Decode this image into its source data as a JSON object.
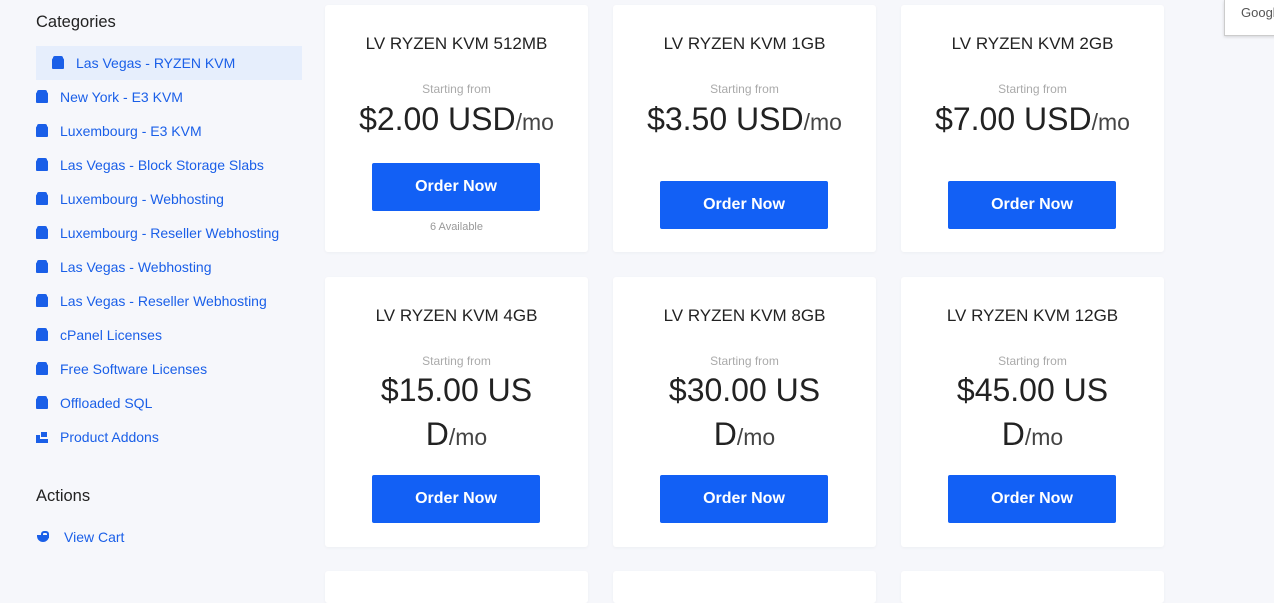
{
  "sidebar": {
    "categories_title": "Categories",
    "categories": [
      {
        "label": "Las Vegas - RYZEN KVM",
        "icon": "box-icon",
        "active": true
      },
      {
        "label": "New York - E3 KVM",
        "icon": "box-icon"
      },
      {
        "label": "Luxembourg - E3 KVM",
        "icon": "box-icon"
      },
      {
        "label": "Las Vegas - Block Storage Slabs",
        "icon": "box-icon"
      },
      {
        "label": "Luxembourg - Webhosting",
        "icon": "box-icon"
      },
      {
        "label": "Luxembourg - Reseller Webhosting",
        "icon": "box-icon"
      },
      {
        "label": "Las Vegas - Webhosting",
        "icon": "box-icon"
      },
      {
        "label": "Las Vegas - Reseller Webhosting",
        "icon": "box-icon"
      },
      {
        "label": "cPanel Licenses",
        "icon": "box-icon"
      },
      {
        "label": "Free Software Licenses",
        "icon": "box-icon"
      },
      {
        "label": "Offloaded SQL",
        "icon": "box-icon"
      },
      {
        "label": "Product Addons",
        "icon": "addons-icon"
      }
    ],
    "actions_title": "Actions",
    "actions": [
      {
        "label": "View Cart",
        "icon": "cart-icon"
      }
    ]
  },
  "products": [
    {
      "name": "LV RYZEN KVM 512MB",
      "starting": "Starting from",
      "price": "$2.00 USD",
      "period": "/mo",
      "button": "Order Now",
      "availability": "6 Available"
    },
    {
      "name": "LV RYZEN KVM 1GB",
      "starting": "Starting from",
      "price": "$3.50 USD",
      "period": "/mo",
      "button": "Order Now"
    },
    {
      "name": "LV RYZEN KVM 2GB",
      "starting": "Starting from",
      "price": "$7.00 USD",
      "period": "/mo",
      "button": "Order Now"
    },
    {
      "name": "LV RYZEN KVM 4GB",
      "starting": "Starting from",
      "price": "$15.00 US",
      "price_wrap": "D",
      "period": "/mo",
      "button": "Order Now"
    },
    {
      "name": "LV RYZEN KVM 8GB",
      "starting": "Starting from",
      "price": "$30.00 US",
      "price_wrap": "D",
      "period": "/mo",
      "button": "Order Now"
    },
    {
      "name": "LV RYZEN KVM 12GB",
      "starting": "Starting from",
      "price": "$45.00 US",
      "price_wrap": "D",
      "period": "/mo",
      "button": "Order Now"
    }
  ],
  "google_widget": {
    "text": "Googl"
  },
  "colors": {
    "accent": "#1260f5",
    "link": "#1a5fe8",
    "background": "#f6f7fb",
    "active_bg": "#e6eefc"
  }
}
